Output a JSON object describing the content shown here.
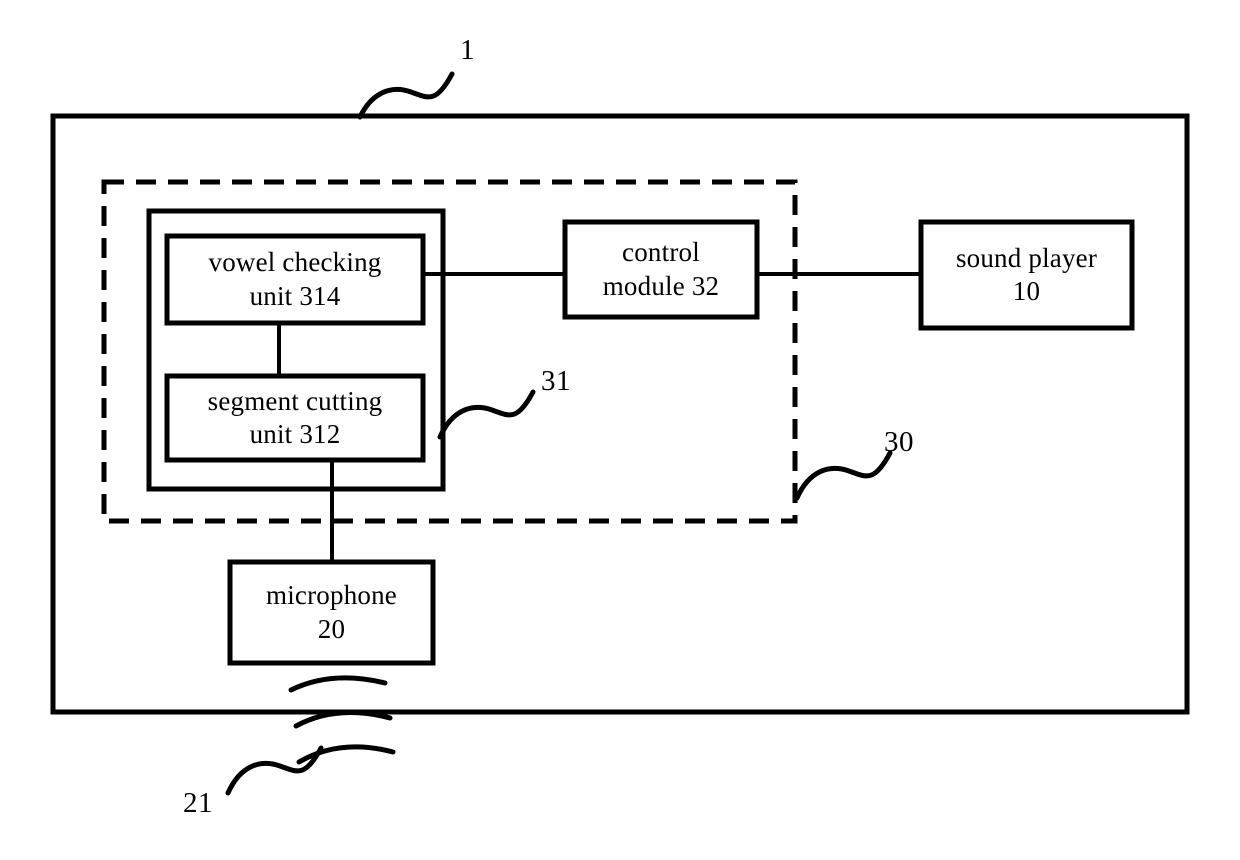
{
  "figure": {
    "type": "patent-block-diagram",
    "background_color": "#ffffff",
    "line_color": "#000000"
  },
  "outer_enclosure": {
    "name": "apparatus-enclosure",
    "reference_numeral": "1",
    "style": "solid"
  },
  "dashed_enclosure": {
    "name": "processing-device-boundary",
    "reference_numeral": "30",
    "style": "dashed"
  },
  "inner_enclosure": {
    "name": "analysis-module-boundary",
    "reference_numeral": "31",
    "style": "solid"
  },
  "blocks": [
    {
      "id": "vowel-checking-unit",
      "line1": "vowel checking",
      "line2": "unit 314",
      "text": "vowel checking\nunit 314"
    },
    {
      "id": "segment-cutting-unit",
      "line1": "segment cutting",
      "line2": "unit 312",
      "text": "segment cutting\nunit 312"
    },
    {
      "id": "control-module",
      "line1": "control",
      "line2": "module 32",
      "text": "control\nmodule 32"
    },
    {
      "id": "sound-player",
      "line1": "sound player",
      "line2": "10",
      "text": "sound player\n10"
    },
    {
      "id": "microphone",
      "line1": "microphone",
      "line2": "20",
      "text": "microphone\n20"
    }
  ],
  "reference_numerals": [
    {
      "id": "ref-1",
      "label": "1",
      "points_to": "outer enclosure (apparatus)"
    },
    {
      "id": "ref-31",
      "label": "31",
      "points_to": "inner solid enclosure"
    },
    {
      "id": "ref-30",
      "label": "30",
      "points_to": "dashed enclosure"
    },
    {
      "id": "ref-21",
      "label": "21",
      "points_to": "acoustic sound waves"
    }
  ],
  "acoustic_waves": {
    "name": "sound-wave-arcs",
    "count": 3,
    "reference_numeral": "21"
  },
  "connections": [
    {
      "from": "vowel-checking-unit",
      "to": "control-module"
    },
    {
      "from": "vowel-checking-unit",
      "to": "segment-cutting-unit"
    },
    {
      "from": "control-module",
      "to": "sound-player"
    },
    {
      "from": "segment-cutting-unit",
      "to": "microphone"
    },
    {
      "from": "acoustic_waves",
      "to": "microphone"
    }
  ]
}
